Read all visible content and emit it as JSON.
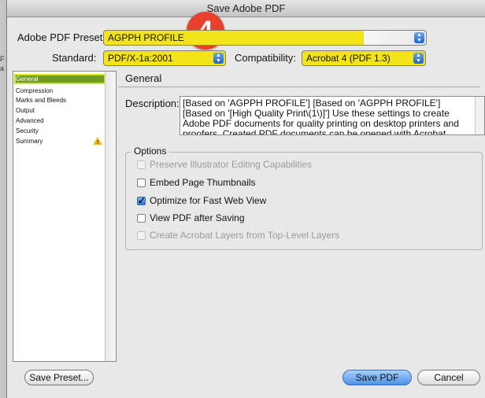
{
  "window": {
    "title": "Save Adobe PDF"
  },
  "badge": {
    "number": "4"
  },
  "preset": {
    "label": "Adobe PDF Preset:",
    "value": "AGPPH PROFILE"
  },
  "standard": {
    "label": "Standard:",
    "value": "PDF/X-1a:2001"
  },
  "compatibility": {
    "label": "Compatibility:",
    "value": "Acrobat 4 (PDF 1.3)"
  },
  "sidebar": {
    "items": [
      {
        "label": "General",
        "selected": true
      },
      {
        "label": "Compression"
      },
      {
        "label": "Marks and Bleeds"
      },
      {
        "label": "Output"
      },
      {
        "label": "Advanced"
      },
      {
        "label": "Security"
      },
      {
        "label": "Summary",
        "icon": "warning-icon"
      }
    ]
  },
  "section": {
    "title": "General"
  },
  "description": {
    "label": "Description:",
    "text": "[Based on 'AGPPH PROFILE'] [Based on 'AGPPH PROFILE'] [Based on '[High Quality Print\\(1\\)]'] Use these settings to create Adobe PDF documents for quality printing on desktop printers and proofers. Created PDF documents can be opened with Acrobat and Adobe"
  },
  "options": {
    "legend": "Options",
    "items": [
      {
        "label": "Preserve Illustrator Editing Capabilities",
        "checked": false,
        "disabled": true
      },
      {
        "label": "Embed Page Thumbnails",
        "checked": false,
        "disabled": false
      },
      {
        "label": "Optimize for Fast Web View",
        "checked": true,
        "disabled": false
      },
      {
        "label": "View PDF after Saving",
        "checked": false,
        "disabled": false
      },
      {
        "label": "Create Acrobat Layers from Top-Level Layers",
        "checked": false,
        "disabled": true
      }
    ]
  },
  "buttons": {
    "save_preset": "Save Preset...",
    "save_pdf": "Save PDF",
    "cancel": "Cancel"
  },
  "colors": {
    "highlight": "#f2e418",
    "badge": "#e8402a",
    "accent": "#2a72d8"
  }
}
